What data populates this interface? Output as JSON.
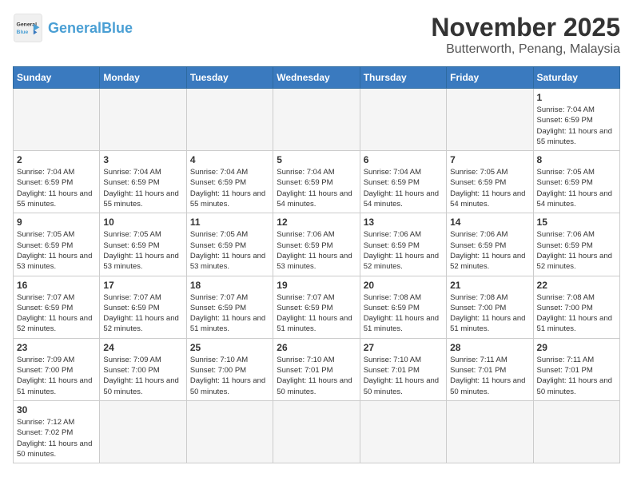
{
  "header": {
    "logo_general": "General",
    "logo_blue": "Blue",
    "month": "November 2025",
    "location": "Butterworth, Penang, Malaysia"
  },
  "weekdays": [
    "Sunday",
    "Monday",
    "Tuesday",
    "Wednesday",
    "Thursday",
    "Friday",
    "Saturday"
  ],
  "weeks": [
    [
      {
        "day": "",
        "sunrise": "",
        "sunset": "",
        "daylight": "",
        "empty": true
      },
      {
        "day": "",
        "sunrise": "",
        "sunset": "",
        "daylight": "",
        "empty": true
      },
      {
        "day": "",
        "sunrise": "",
        "sunset": "",
        "daylight": "",
        "empty": true
      },
      {
        "day": "",
        "sunrise": "",
        "sunset": "",
        "daylight": "",
        "empty": true
      },
      {
        "day": "",
        "sunrise": "",
        "sunset": "",
        "daylight": "",
        "empty": true
      },
      {
        "day": "",
        "sunrise": "",
        "sunset": "",
        "daylight": "",
        "empty": true
      },
      {
        "day": "1",
        "sunrise": "Sunrise: 7:04 AM",
        "sunset": "Sunset: 6:59 PM",
        "daylight": "Daylight: 11 hours and 55 minutes.",
        "empty": false
      }
    ],
    [
      {
        "day": "2",
        "sunrise": "Sunrise: 7:04 AM",
        "sunset": "Sunset: 6:59 PM",
        "daylight": "Daylight: 11 hours and 55 minutes.",
        "empty": false
      },
      {
        "day": "3",
        "sunrise": "Sunrise: 7:04 AM",
        "sunset": "Sunset: 6:59 PM",
        "daylight": "Daylight: 11 hours and 55 minutes.",
        "empty": false
      },
      {
        "day": "4",
        "sunrise": "Sunrise: 7:04 AM",
        "sunset": "Sunset: 6:59 PM",
        "daylight": "Daylight: 11 hours and 55 minutes.",
        "empty": false
      },
      {
        "day": "5",
        "sunrise": "Sunrise: 7:04 AM",
        "sunset": "Sunset: 6:59 PM",
        "daylight": "Daylight: 11 hours and 54 minutes.",
        "empty": false
      },
      {
        "day": "6",
        "sunrise": "Sunrise: 7:04 AM",
        "sunset": "Sunset: 6:59 PM",
        "daylight": "Daylight: 11 hours and 54 minutes.",
        "empty": false
      },
      {
        "day": "7",
        "sunrise": "Sunrise: 7:05 AM",
        "sunset": "Sunset: 6:59 PM",
        "daylight": "Daylight: 11 hours and 54 minutes.",
        "empty": false
      },
      {
        "day": "8",
        "sunrise": "Sunrise: 7:05 AM",
        "sunset": "Sunset: 6:59 PM",
        "daylight": "Daylight: 11 hours and 54 minutes.",
        "empty": false
      }
    ],
    [
      {
        "day": "9",
        "sunrise": "Sunrise: 7:05 AM",
        "sunset": "Sunset: 6:59 PM",
        "daylight": "Daylight: 11 hours and 53 minutes.",
        "empty": false
      },
      {
        "day": "10",
        "sunrise": "Sunrise: 7:05 AM",
        "sunset": "Sunset: 6:59 PM",
        "daylight": "Daylight: 11 hours and 53 minutes.",
        "empty": false
      },
      {
        "day": "11",
        "sunrise": "Sunrise: 7:05 AM",
        "sunset": "Sunset: 6:59 PM",
        "daylight": "Daylight: 11 hours and 53 minutes.",
        "empty": false
      },
      {
        "day": "12",
        "sunrise": "Sunrise: 7:06 AM",
        "sunset": "Sunset: 6:59 PM",
        "daylight": "Daylight: 11 hours and 53 minutes.",
        "empty": false
      },
      {
        "day": "13",
        "sunrise": "Sunrise: 7:06 AM",
        "sunset": "Sunset: 6:59 PM",
        "daylight": "Daylight: 11 hours and 52 minutes.",
        "empty": false
      },
      {
        "day": "14",
        "sunrise": "Sunrise: 7:06 AM",
        "sunset": "Sunset: 6:59 PM",
        "daylight": "Daylight: 11 hours and 52 minutes.",
        "empty": false
      },
      {
        "day": "15",
        "sunrise": "Sunrise: 7:06 AM",
        "sunset": "Sunset: 6:59 PM",
        "daylight": "Daylight: 11 hours and 52 minutes.",
        "empty": false
      }
    ],
    [
      {
        "day": "16",
        "sunrise": "Sunrise: 7:07 AM",
        "sunset": "Sunset: 6:59 PM",
        "daylight": "Daylight: 11 hours and 52 minutes.",
        "empty": false
      },
      {
        "day": "17",
        "sunrise": "Sunrise: 7:07 AM",
        "sunset": "Sunset: 6:59 PM",
        "daylight": "Daylight: 11 hours and 52 minutes.",
        "empty": false
      },
      {
        "day": "18",
        "sunrise": "Sunrise: 7:07 AM",
        "sunset": "Sunset: 6:59 PM",
        "daylight": "Daylight: 11 hours and 51 minutes.",
        "empty": false
      },
      {
        "day": "19",
        "sunrise": "Sunrise: 7:07 AM",
        "sunset": "Sunset: 6:59 PM",
        "daylight": "Daylight: 11 hours and 51 minutes.",
        "empty": false
      },
      {
        "day": "20",
        "sunrise": "Sunrise: 7:08 AM",
        "sunset": "Sunset: 6:59 PM",
        "daylight": "Daylight: 11 hours and 51 minutes.",
        "empty": false
      },
      {
        "day": "21",
        "sunrise": "Sunrise: 7:08 AM",
        "sunset": "Sunset: 7:00 PM",
        "daylight": "Daylight: 11 hours and 51 minutes.",
        "empty": false
      },
      {
        "day": "22",
        "sunrise": "Sunrise: 7:08 AM",
        "sunset": "Sunset: 7:00 PM",
        "daylight": "Daylight: 11 hours and 51 minutes.",
        "empty": false
      }
    ],
    [
      {
        "day": "23",
        "sunrise": "Sunrise: 7:09 AM",
        "sunset": "Sunset: 7:00 PM",
        "daylight": "Daylight: 11 hours and 51 minutes.",
        "empty": false
      },
      {
        "day": "24",
        "sunrise": "Sunrise: 7:09 AM",
        "sunset": "Sunset: 7:00 PM",
        "daylight": "Daylight: 11 hours and 50 minutes.",
        "empty": false
      },
      {
        "day": "25",
        "sunrise": "Sunrise: 7:10 AM",
        "sunset": "Sunset: 7:00 PM",
        "daylight": "Daylight: 11 hours and 50 minutes.",
        "empty": false
      },
      {
        "day": "26",
        "sunrise": "Sunrise: 7:10 AM",
        "sunset": "Sunset: 7:01 PM",
        "daylight": "Daylight: 11 hours and 50 minutes.",
        "empty": false
      },
      {
        "day": "27",
        "sunrise": "Sunrise: 7:10 AM",
        "sunset": "Sunset: 7:01 PM",
        "daylight": "Daylight: 11 hours and 50 minutes.",
        "empty": false
      },
      {
        "day": "28",
        "sunrise": "Sunrise: 7:11 AM",
        "sunset": "Sunset: 7:01 PM",
        "daylight": "Daylight: 11 hours and 50 minutes.",
        "empty": false
      },
      {
        "day": "29",
        "sunrise": "Sunrise: 7:11 AM",
        "sunset": "Sunset: 7:01 PM",
        "daylight": "Daylight: 11 hours and 50 minutes.",
        "empty": false
      }
    ],
    [
      {
        "day": "30",
        "sunrise": "Sunrise: 7:12 AM",
        "sunset": "Sunset: 7:02 PM",
        "daylight": "Daylight: 11 hours and 50 minutes.",
        "empty": false
      },
      {
        "day": "",
        "sunrise": "",
        "sunset": "",
        "daylight": "",
        "empty": true
      },
      {
        "day": "",
        "sunrise": "",
        "sunset": "",
        "daylight": "",
        "empty": true
      },
      {
        "day": "",
        "sunrise": "",
        "sunset": "",
        "daylight": "",
        "empty": true
      },
      {
        "day": "",
        "sunrise": "",
        "sunset": "",
        "daylight": "",
        "empty": true
      },
      {
        "day": "",
        "sunrise": "",
        "sunset": "",
        "daylight": "",
        "empty": true
      },
      {
        "day": "",
        "sunrise": "",
        "sunset": "",
        "daylight": "",
        "empty": true
      }
    ]
  ]
}
